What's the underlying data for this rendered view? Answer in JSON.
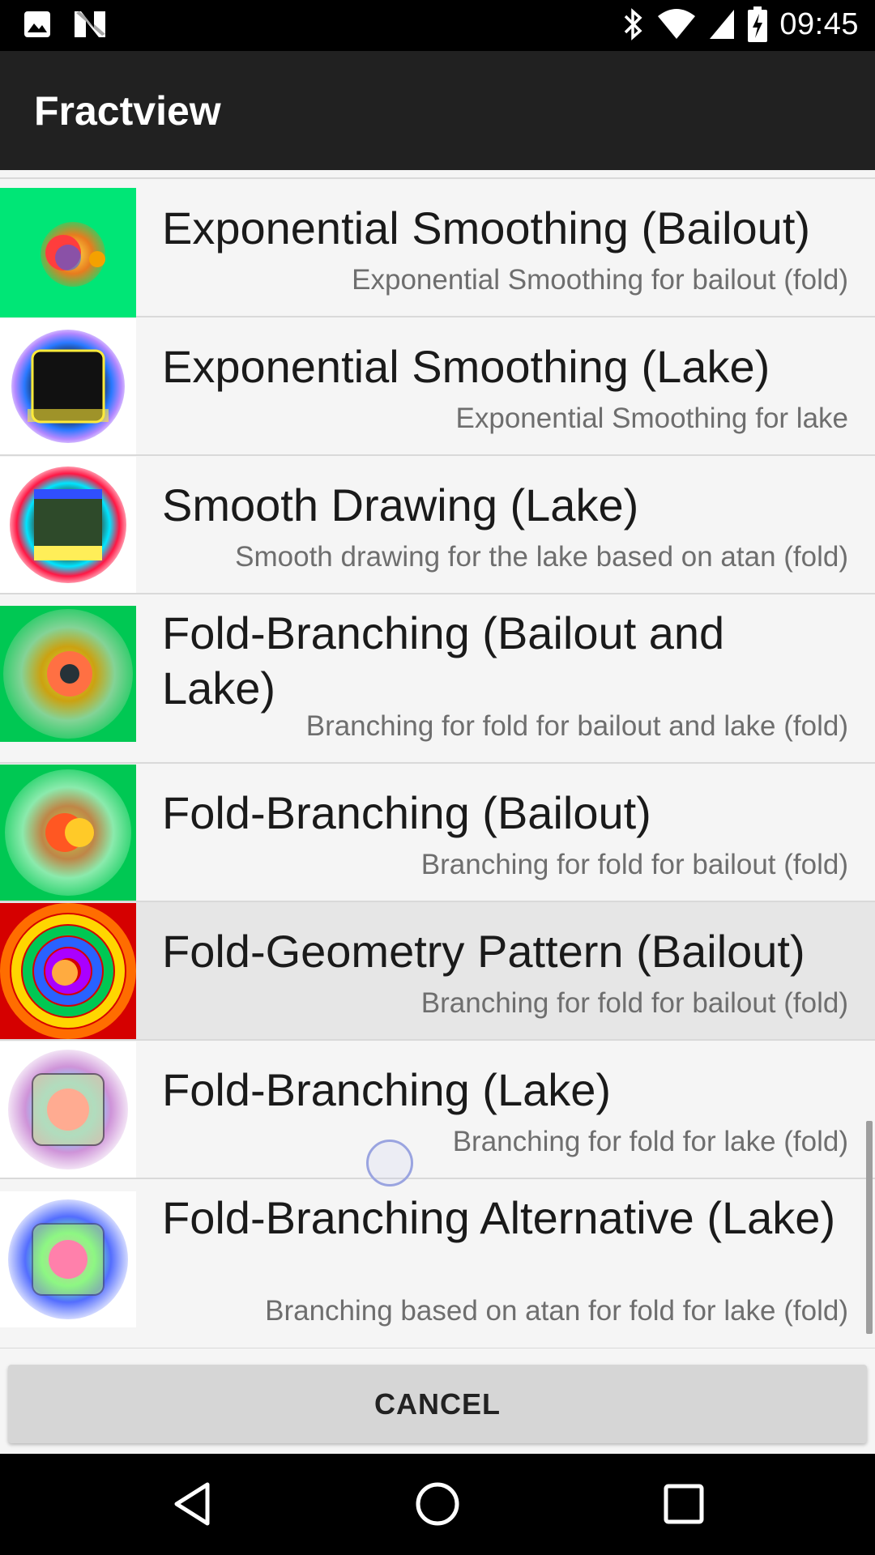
{
  "status_bar": {
    "time": "09:45",
    "left_icons": [
      "image-icon",
      "n-icon"
    ],
    "right_icons": [
      "bluetooth-icon",
      "wifi-icon",
      "cell-signal-icon",
      "battery-charging-icon"
    ]
  },
  "app_bar": {
    "title": "Fractview"
  },
  "list": {
    "items": [
      {
        "title": "Exponential Smoothing (Bailout)",
        "subtitle": "Exponential Smoothing for bailout (fold)",
        "thumb": "green-mandelbrot-thumbnail"
      },
      {
        "title": "Exponential Smoothing (Lake)",
        "subtitle": "Exponential Smoothing for lake",
        "thumb": "dark-lake-thumbnail"
      },
      {
        "title": "Smooth Drawing (Lake)",
        "subtitle": "Smooth drawing for the lake based on atan (fold)",
        "thumb": "rainbow-lake-thumbnail"
      },
      {
        "title": "Fold-Branching (Bailout and Lake)",
        "subtitle": "Branching for fold for bailout and lake (fold)",
        "thumb": "green-branching-thumbnail"
      },
      {
        "title": "Fold-Branching (Bailout)",
        "subtitle": "Branching for fold for bailout (fold)",
        "thumb": "green-branching-bailout-thumbnail"
      },
      {
        "title": "Fold-Geometry Pattern (Bailout)",
        "subtitle": "Branching for fold for bailout (fold)",
        "thumb": "rainbow-geometry-thumbnail"
      },
      {
        "title": "Fold-Branching (Lake)",
        "subtitle": "Branching for fold for lake (fold)",
        "thumb": "rainbow-star-lake-thumbnail"
      },
      {
        "title": "Fold-Branching Alternative (Lake)",
        "subtitle": "Branching based on atan for fold for lake (fold)",
        "thumb": "rainbow-star-alt-thumbnail"
      }
    ]
  },
  "footer": {
    "cancel_label": "CANCEL"
  },
  "nav_bar": {
    "icons": [
      "back-icon",
      "home-icon",
      "recents-icon"
    ]
  },
  "colors": {
    "app_bar": "#212121",
    "list_bg": "#f5f5f5",
    "pressed_row": "#e6e6e6"
  }
}
